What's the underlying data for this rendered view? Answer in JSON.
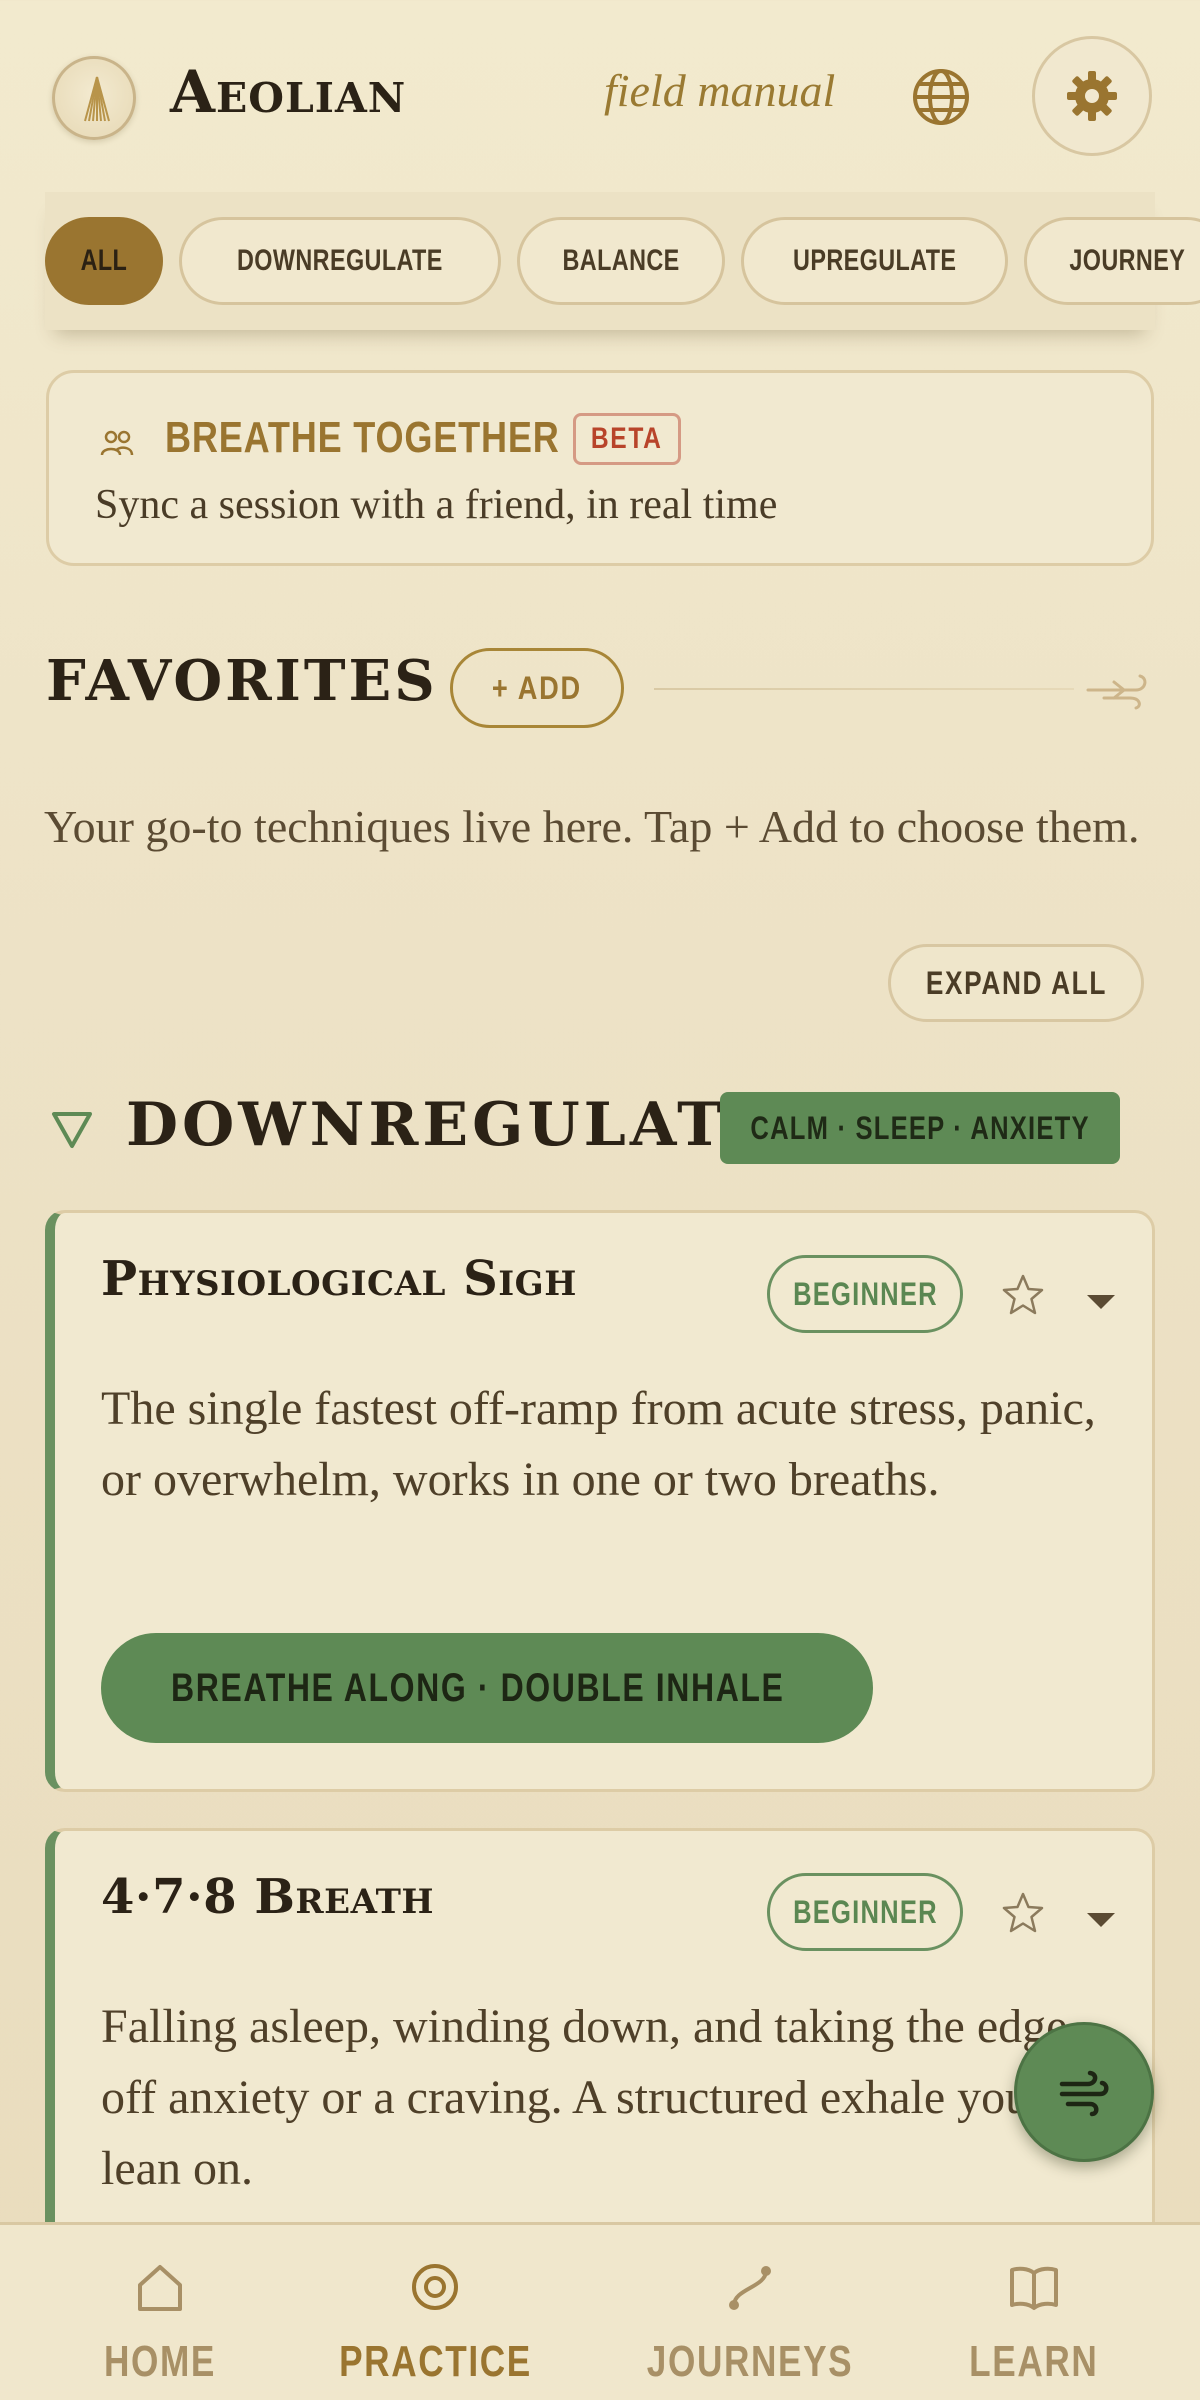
{
  "header": {
    "title": "Aeolian",
    "subtitle": "field manual"
  },
  "filters": [
    {
      "label": "ALL",
      "active": true
    },
    {
      "label": "DOWNREGULATE",
      "active": false
    },
    {
      "label": "BALANCE",
      "active": false
    },
    {
      "label": "UPREGULATE",
      "active": false
    },
    {
      "label": "JOURNEY",
      "active": false
    }
  ],
  "together": {
    "title": "BREATHE TOGETHER",
    "badge": "BETA",
    "description": "Sync a session with a friend, in real time"
  },
  "favorites": {
    "title": "FAVORITES",
    "add_label": "+ ADD",
    "empty_text": "Your go-to techniques live here. Tap + Add to choose them.",
    "expand_label": "EXPAND ALL"
  },
  "section": {
    "title": "DOWNREGULATE",
    "tag": "CALM · SLEEP · ANXIETY"
  },
  "cards": [
    {
      "title": "Physiological Sigh",
      "level": "BEGINNER",
      "description": "The single fastest off-ramp from acute stress, panic, or overwhelm, works in one or two breaths.",
      "action": "BREATHE ALONG · DOUBLE INHALE"
    },
    {
      "title": "4·7·8 Breath",
      "level": "BEGINNER",
      "description": "Falling asleep, winding down, and taking the edge off anxiety or a craving. A structured exhale you can lean on."
    }
  ],
  "nav": [
    {
      "label": "HOME",
      "icon": "home-icon",
      "active": false
    },
    {
      "label": "PRACTICE",
      "icon": "target-icon",
      "active": true
    },
    {
      "label": "JOURNEYS",
      "icon": "path-icon",
      "active": false
    },
    {
      "label": "LEARN",
      "icon": "book-icon",
      "active": false
    }
  ],
  "colors": {
    "accent": "#9a7530",
    "green": "#5e8a55",
    "background": "#efe6cb",
    "beta": "#b8442a"
  }
}
